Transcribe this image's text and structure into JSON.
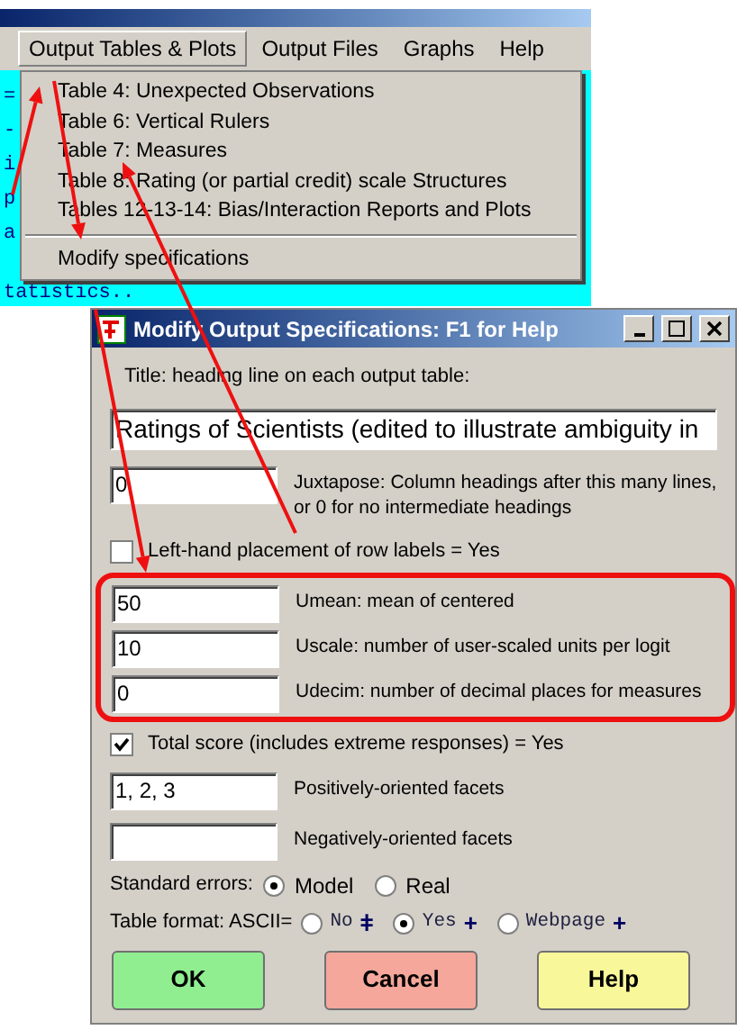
{
  "app_window": {
    "menubar": [
      {
        "label": "Output Tables & Plots",
        "selected": true
      },
      {
        "label": "Output Files",
        "selected": false
      },
      {
        "label": "Graphs",
        "selected": false
      },
      {
        "label": "Help",
        "selected": false
      }
    ],
    "console_lines": [
      "=",
      "-",
      "i",
      "p",
      "a",
      "tatistics.."
    ],
    "menu": {
      "items": [
        "Table 4: Unexpected Observations",
        "Table 6: Vertical Rulers",
        "Table 7: Measures",
        "Table 8: Rating (or partial credit) scale Structures",
        "Tables 12-13-14: Bias/Interaction Reports and Plots"
      ],
      "footer_items": [
        "Modify specifications"
      ]
    }
  },
  "dialog": {
    "title": "Modify Output Specifications: F1 for Help",
    "title_label": "Title: heading line on each output table:",
    "title_value": "Ratings of Scientists (edited to illustrate ambiguity in",
    "juxtapose": {
      "value": "0",
      "label": "Juxtapose: Column headings after this many lines, or 0 for no intermediate headings"
    },
    "left_hand_labels": {
      "checked": false,
      "label": "Left-hand placement of row labels = Yes"
    },
    "highlighted_fields": [
      {
        "value": "50",
        "label": "Umean: mean of centered"
      },
      {
        "value": "10",
        "label": "Uscale: number of user-scaled units per logit"
      },
      {
        "value": "0",
        "label": "Udecim: number of decimal places for measures"
      }
    ],
    "total_score": {
      "checked": true,
      "label": "Total score (includes extreme responses) = Yes"
    },
    "facet_fields": [
      {
        "value": "1, 2, 3",
        "label": "Positively-oriented facets"
      },
      {
        "label": "Negatively-oriented facets"
      }
    ],
    "standard_errors": {
      "label": "Standard errors:",
      "options": [
        {
          "label": "Model",
          "selected": true
        },
        {
          "label": "Real",
          "selected": false
        }
      ]
    },
    "table_format": {
      "label": "Table format: ASCII=",
      "options": [
        {
          "label": "No",
          "suffix": "ǂ",
          "selected": false
        },
        {
          "label": "Yes",
          "suffix": "+",
          "selected": true
        },
        {
          "label": "Webpage",
          "suffix": "+",
          "selected": false
        }
      ]
    },
    "buttons": [
      {
        "label": "OK",
        "color": "#90ee90"
      },
      {
        "label": "Cancel",
        "color": "#f4a79a"
      },
      {
        "label": "Help",
        "color": "#f8f89a"
      }
    ]
  }
}
